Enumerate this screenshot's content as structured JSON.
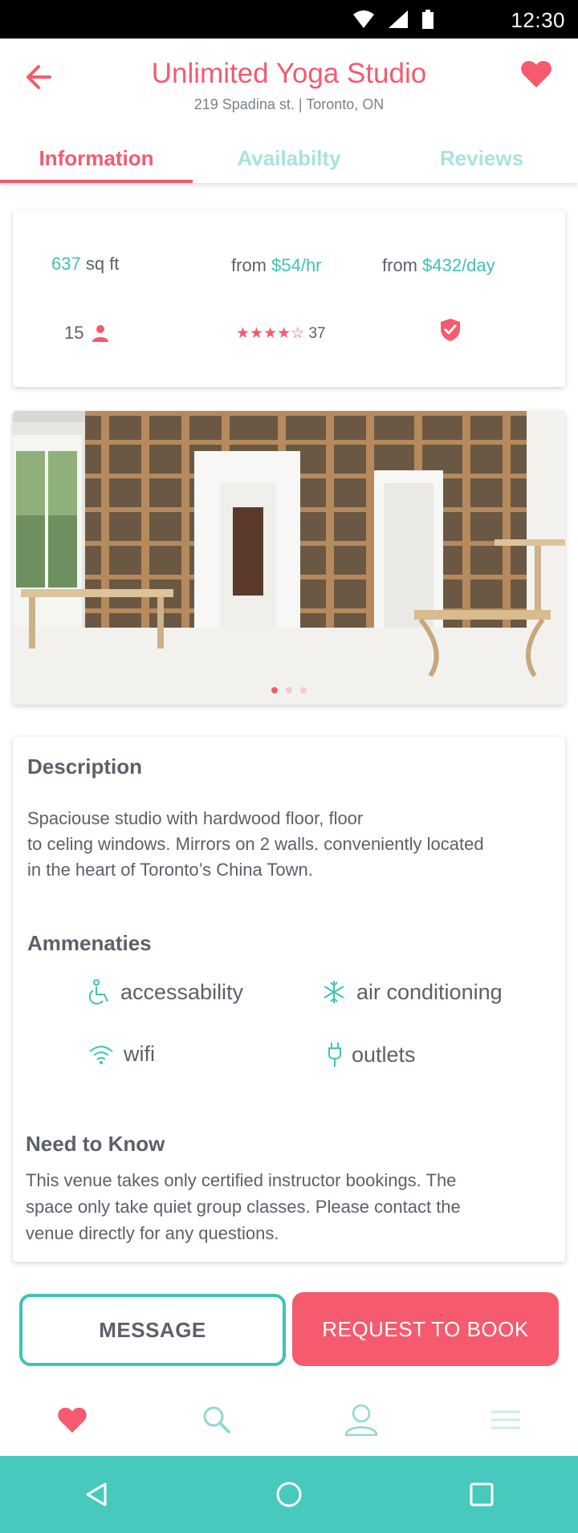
{
  "status_bar": {
    "time": "12:30"
  },
  "header": {
    "title": "Unlimited Yoga Studio",
    "subtitle": "219 Spadina st. | Toronto, ON"
  },
  "tabs": [
    {
      "label": "Information",
      "active": true
    },
    {
      "label": "Availabilty",
      "active": false
    },
    {
      "label": "Reviews",
      "active": false
    }
  ],
  "stats": {
    "area_value": "637",
    "area_unit": "sq ft",
    "hourly_prefix": "from",
    "hourly_price": "$54/hr",
    "daily_prefix": "from",
    "daily_price": "$432/day",
    "capacity": "15",
    "rating_stars": "★★★★☆",
    "rating_count": "37"
  },
  "gallery": {
    "slide_count": 3,
    "active_slide": 1
  },
  "description": {
    "heading": "Description",
    "lines": [
      "Spaciouse studio with hardwood floor, floor",
      "to celing windows. Mirrors on 2 walls. conveniently located",
      "in the heart of Toronto’s China Town."
    ]
  },
  "amenities": {
    "heading": "Ammenaties",
    "items": [
      {
        "label": "accessability",
        "icon": "wheelchair-icon"
      },
      {
        "label": "air conditioning",
        "icon": "snowflake-icon"
      },
      {
        "label": "wifi",
        "icon": "wifi-icon"
      },
      {
        "label": "outlets",
        "icon": "plug-icon"
      }
    ]
  },
  "need_to_know": {
    "heading": "Need to Know",
    "lines": [
      "This venue takes only certified instructor bookings. The",
      "space only take quiet group classes. Please contact the",
      "venue directly for any questions."
    ]
  },
  "actions": {
    "message": "MESSAGE",
    "book": "REQUEST TO BOOK"
  },
  "bottom_nav": [
    "heart-icon",
    "search-icon",
    "profile-icon",
    "menu-icon"
  ],
  "colors": {
    "accent": "#f55a6e",
    "teal": "#3fc3b6",
    "nav_bar": "#48c9be"
  }
}
